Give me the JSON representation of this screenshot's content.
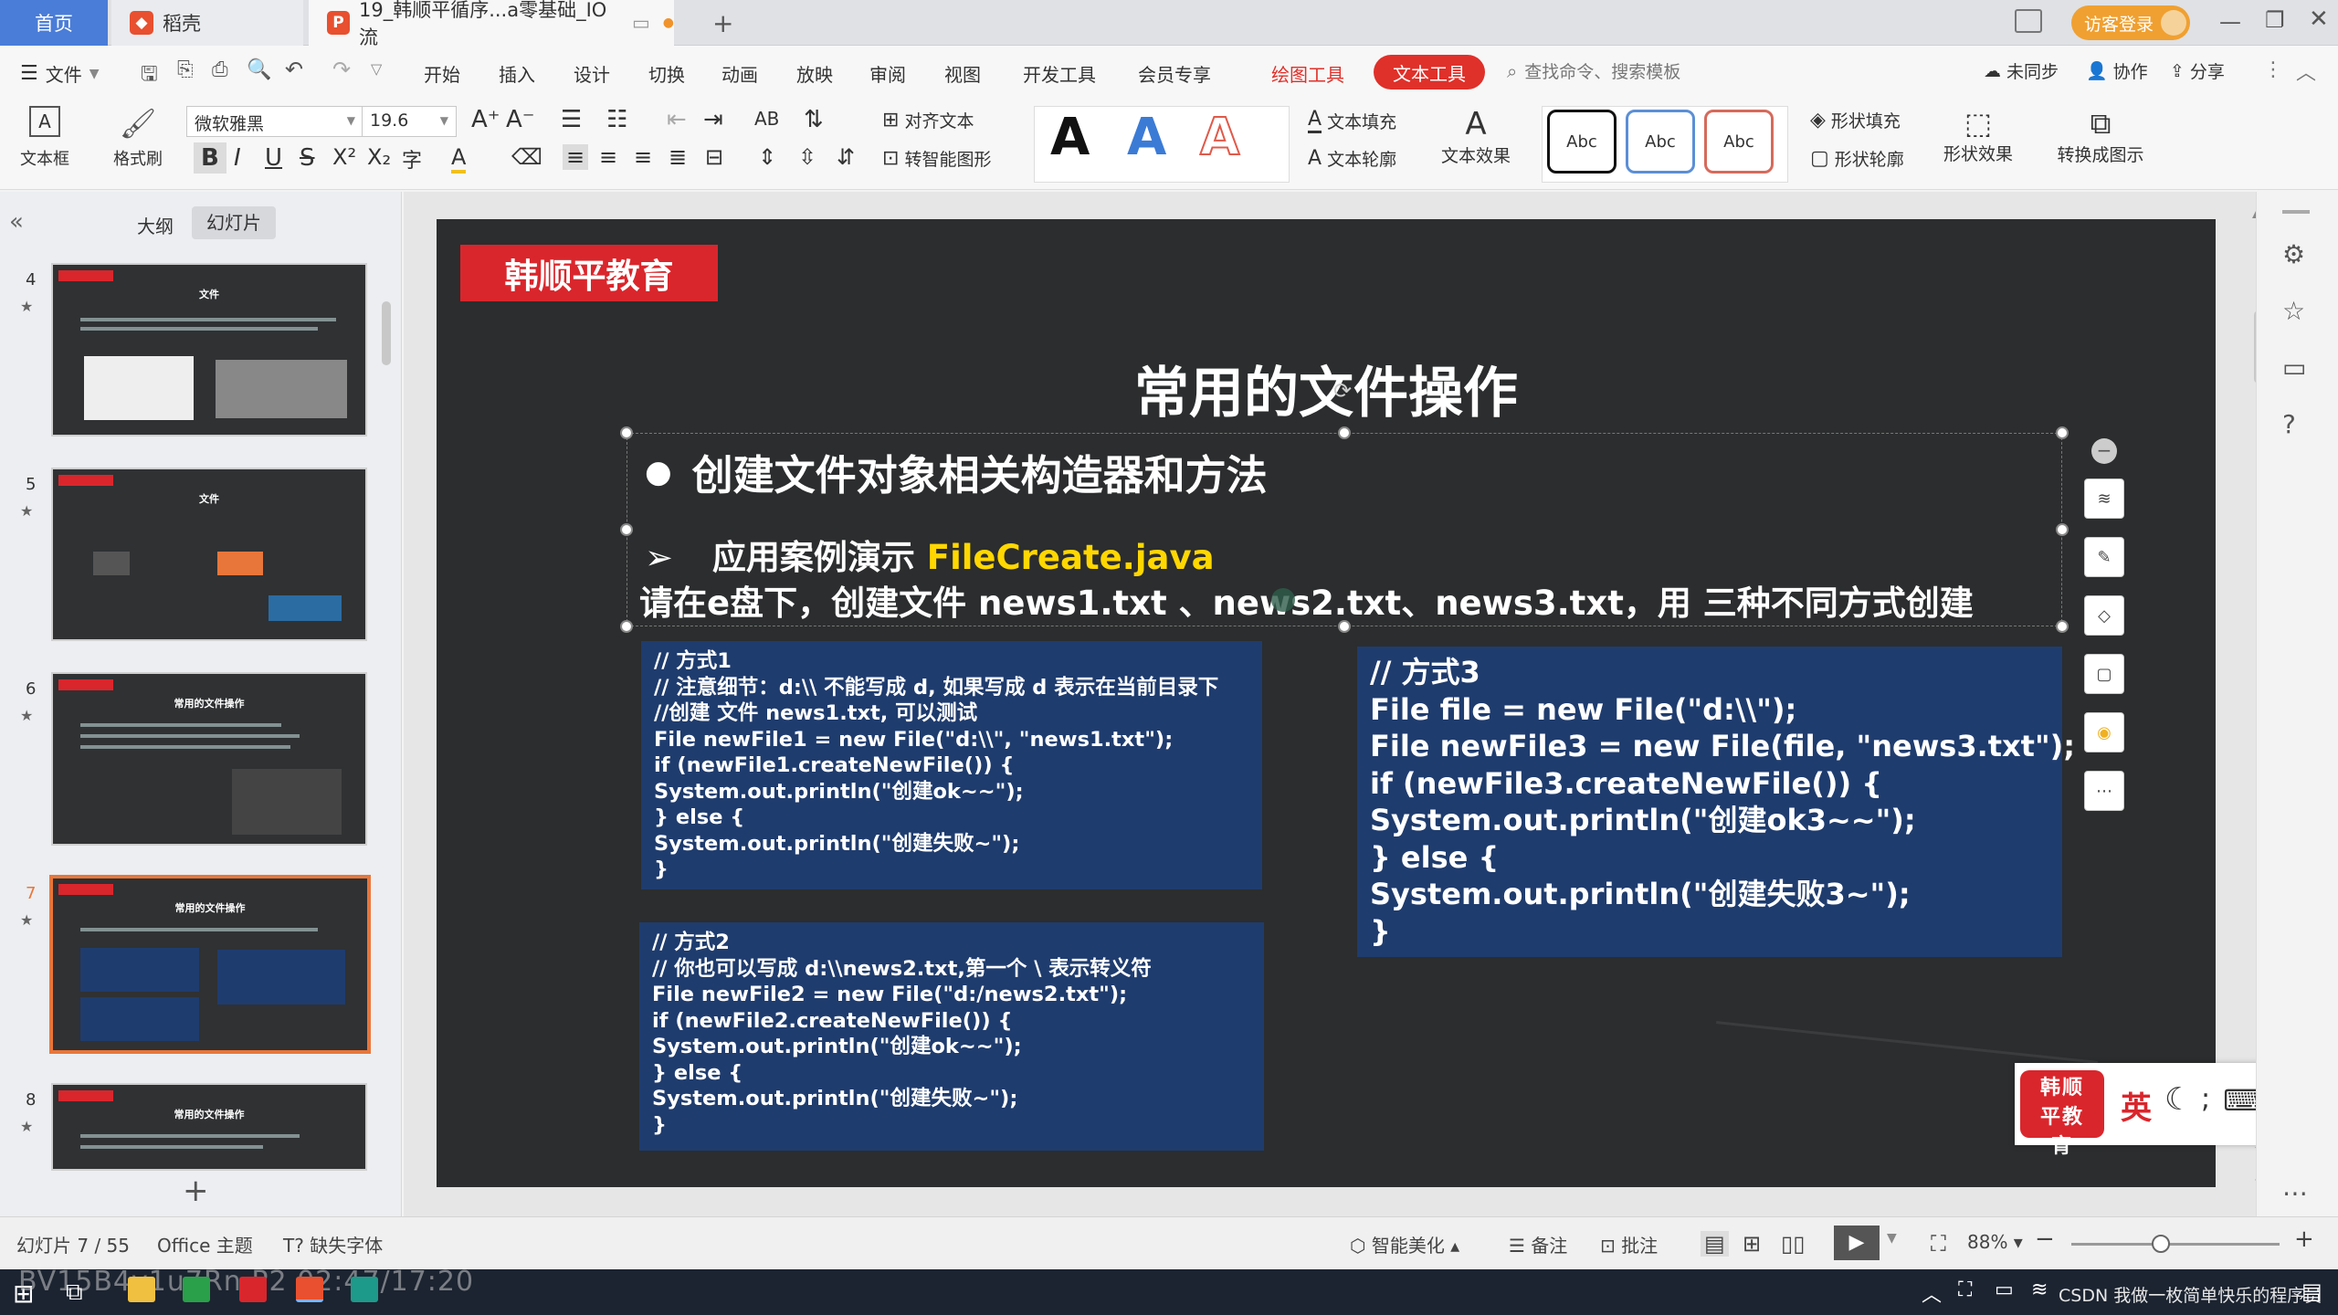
{
  "tabs": {
    "home": "首页",
    "docer": "稻壳",
    "doc": "19_韩顺平循序...a零基础_IO流",
    "add": "+"
  },
  "titlebar": {
    "login": "访客登录"
  },
  "menu": {
    "file": "文件",
    "items": [
      "开始",
      "插入",
      "设计",
      "切换",
      "动画",
      "放映",
      "审阅",
      "视图",
      "开发工具",
      "会员专享"
    ],
    "draw_tools": "绘图工具",
    "text_tools": "文本工具",
    "search": "查找命令、搜索模板",
    "sync": "未同步",
    "collab": "协作",
    "share": "分享"
  },
  "ribbon": {
    "textbox": "文本框",
    "format_painter": "格式刷",
    "font": "微软雅黑",
    "size": "19.6",
    "align_text": "对齐文本",
    "smart_shape": "转智能图形",
    "text_fill": "文本填充",
    "text_outline": "文本轮廓",
    "text_effect": "文本效果",
    "abc": "Abc",
    "shape_fill": "形状填充",
    "shape_outline": "形状轮廓",
    "shape_effect": "形状效果",
    "convert_diagram": "转换成图示",
    "big_a": "A"
  },
  "leftpanel": {
    "outline_tab": "大纲",
    "slides_tab": "幻灯片",
    "add": "+",
    "thumbs": [
      {
        "num": "4",
        "title": "文件"
      },
      {
        "num": "5",
        "title": "文件"
      },
      {
        "num": "6",
        "title": "常用的文件操作"
      },
      {
        "num": "7",
        "title": "常用的文件操作"
      },
      {
        "num": "8",
        "title": "常用的文件操作"
      }
    ]
  },
  "slide": {
    "logo": "韩顺平教育",
    "title": "常用的文件操作",
    "bullet1": "创建文件对象相关构造器和方法",
    "sub_prefix": "应用案例演示 ",
    "sub_file": "FileCreate.java",
    "task": "请在e盘下，创建文件 news1.txt 、news2.txt、news3.txt，用 三种不同方式创建",
    "code1": [
      "// 方式1",
      "// 注意细节：d:\\\\ 不能写成 d, 如果写成 d 表示在当前目录下",
      "//创建 文件 news1.txt, 可以测试",
      "File newFile1 = new File(\"d:\\\\\", \"news1.txt\");",
      "if (newFile1.createNewFile()) {",
      "System.out.println(\"创建ok~~\");",
      "} else {",
      "System.out.println(\"创建失败~\");",
      "}"
    ],
    "code2": [
      "// 方式2",
      "// 你也可以写成 d:\\\\news2.txt,第一个 \\ 表示转义符",
      "File newFile2 = new File(\"d:/news2.txt\");",
      "if (newFile2.createNewFile()) {",
      "System.out.println(\"创建ok~~\");",
      "} else {",
      "System.out.println(\"创建失败~\");",
      "}"
    ],
    "code3": [
      "// 方式3",
      "File file = new File(\"d:\\\\\");",
      "File newFile3 = new File(file, \"news3.txt\");",
      "if (newFile3.createNewFile()) {",
      "System.out.println(\"创建ok3~~\");",
      "} else {",
      "System.out.println(\"创建失败3~\");",
      "}"
    ]
  },
  "ime": {
    "brand": "韩顺平教育",
    "lang": "英"
  },
  "status": {
    "slide_count": "幻灯片 7 / 55",
    "theme": "Office 主题",
    "missing_font": "缺失字体",
    "beautify": "智能美化",
    "notes": "备注",
    "comment": "批注",
    "zoom": "88%"
  },
  "taskbar": {
    "watermark": "BV15B4y1u7Rn P2 02:47/17:20",
    "csdn": "CSDN 我做一枚简单快乐的程序员"
  },
  "colors": {
    "accent_red": "#e0302a",
    "code_bg": "#1f3c6e",
    "slide_bg": "#2b2d2e",
    "highlight_yellow": "#ffd700"
  }
}
